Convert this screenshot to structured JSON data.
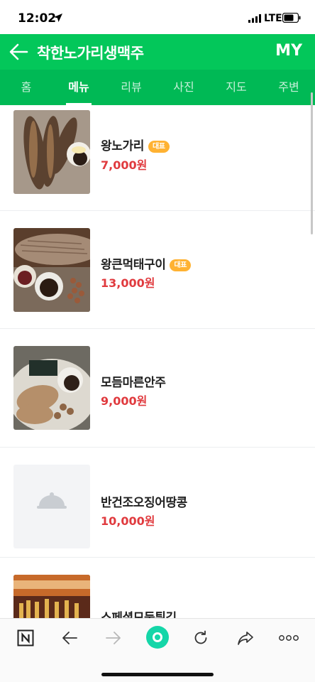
{
  "status_bar": {
    "time": "12:02",
    "network": "LTE"
  },
  "header": {
    "title": "착한노가리생맥주",
    "my_label": "MY"
  },
  "tabs": [
    {
      "label": "홈",
      "active": false
    },
    {
      "label": "메뉴",
      "active": true
    },
    {
      "label": "리뷰",
      "active": false
    },
    {
      "label": "사진",
      "active": false
    },
    {
      "label": "지도",
      "active": false
    },
    {
      "label": "주변",
      "active": false
    }
  ],
  "menu_items": [
    {
      "name": "왕노가리",
      "badge": "대표",
      "price": "7,000원",
      "image": "grilled-fish-photo"
    },
    {
      "name": "왕큰먹태구이",
      "badge": "대표",
      "price": "13,000원",
      "image": "dried-pollack-photo"
    },
    {
      "name": "모듬마른안주",
      "badge": "",
      "price": "9,000원",
      "image": "dried-snacks-photo"
    },
    {
      "name": "반건조오징어땅콩",
      "badge": "",
      "price": "10,000원",
      "image": "placeholder-cloche-icon"
    },
    {
      "name": "스페셜모둠튀김",
      "badge": "",
      "price": "",
      "image": "fried-platter-photo"
    }
  ],
  "browser_bar": {
    "icons": [
      "naver-n-icon",
      "back-arrow-icon",
      "forward-arrow-icon",
      "green-dot-icon",
      "refresh-icon",
      "share-icon",
      "more-icon"
    ]
  },
  "colors": {
    "brand_green": "#03c75a",
    "tab_green": "#00b955",
    "price_red": "#e03a3e",
    "badge_orange": "#ffb232"
  }
}
